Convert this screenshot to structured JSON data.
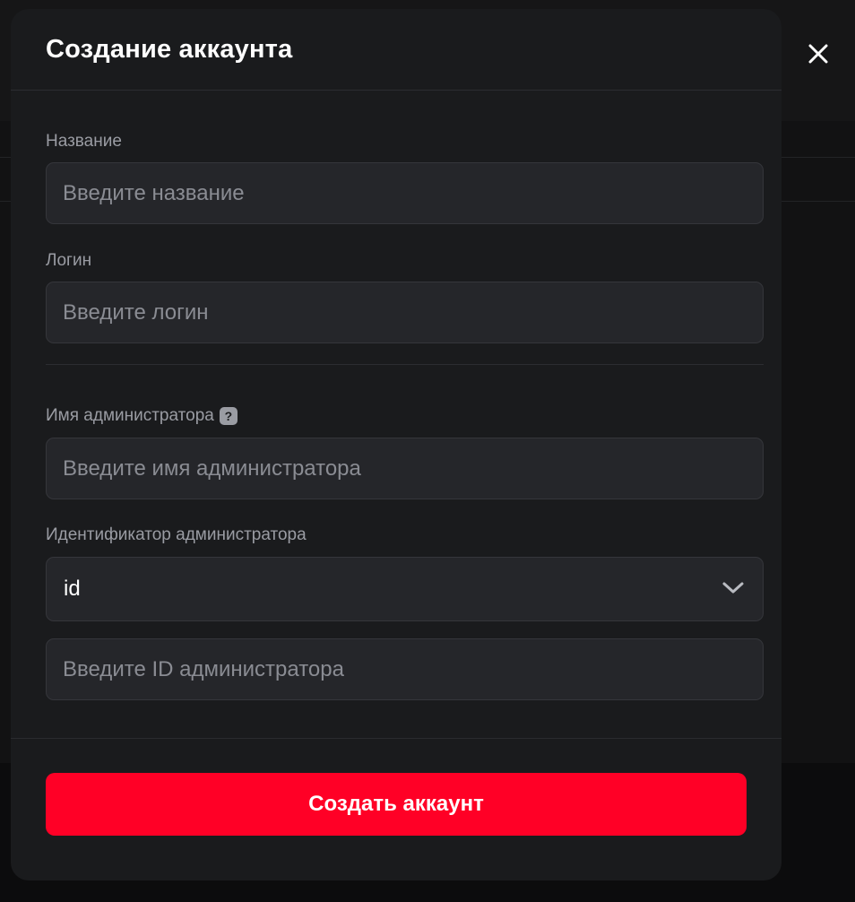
{
  "modal": {
    "title": "Создание аккаунта",
    "close_icon": "close-icon"
  },
  "fields": {
    "name": {
      "label": "Название",
      "placeholder": "Введите название"
    },
    "login": {
      "label": "Логин",
      "placeholder": "Введите логин"
    },
    "admin_name": {
      "label": "Имя администратора",
      "placeholder": "Введите имя администратора",
      "help_icon": "question-icon"
    },
    "admin_identifier": {
      "label": "Идентификатор администратора",
      "selected": "id",
      "placeholder": "Введите ID администратора"
    }
  },
  "submit": {
    "label": "Создать аккаунт"
  },
  "colors": {
    "accent": "#ff0026",
    "modal_bg": "#1a1b1d",
    "input_bg": "#25262a"
  }
}
